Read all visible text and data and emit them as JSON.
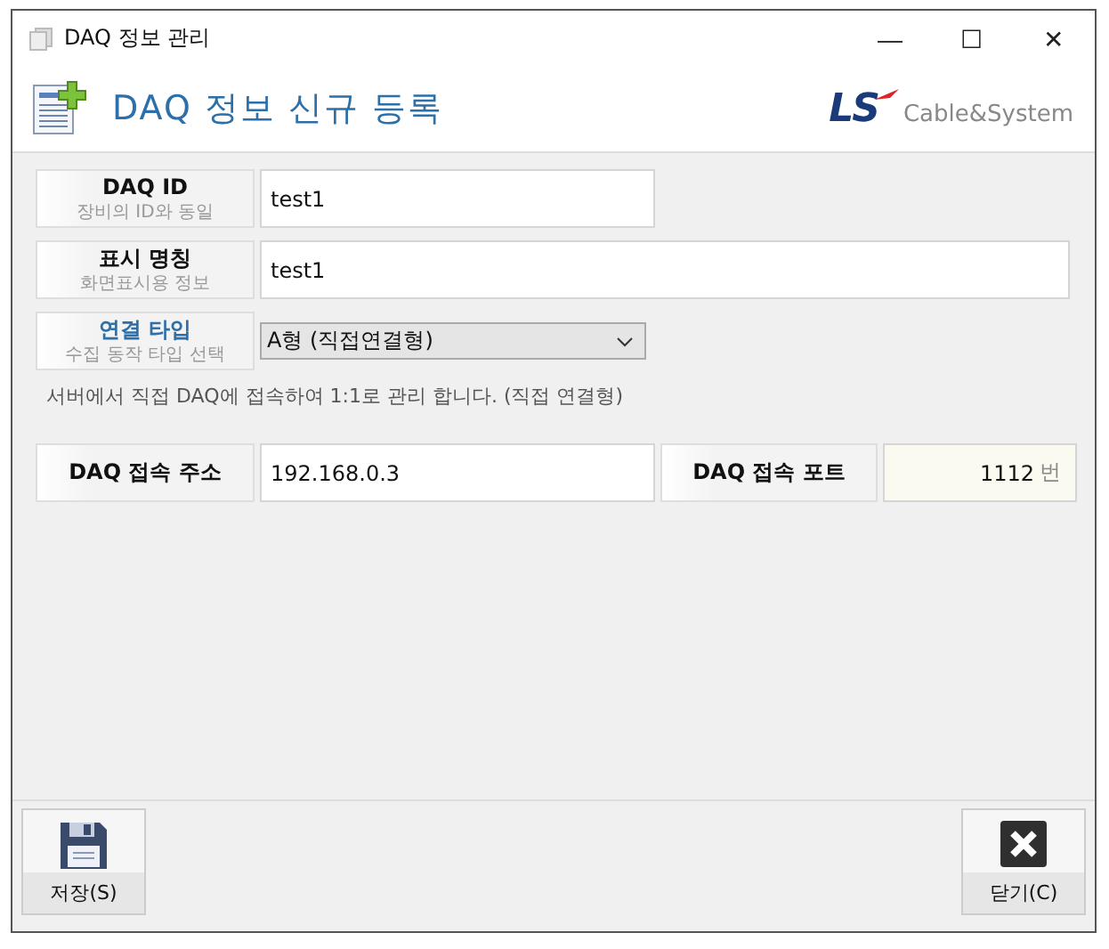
{
  "window": {
    "title": "DAQ 정보 관리",
    "controls": [
      "—",
      "☐",
      "✕"
    ]
  },
  "header": {
    "title": "DAQ 정보 신규 등록",
    "logo_mark": "LS",
    "logo_text": "Cable&System"
  },
  "fields": [
    {
      "kind": "text",
      "label": "DAQ ID",
      "sublabel": "장비의 ID와 동일",
      "emphasized": false,
      "value": "test1",
      "wide": false
    },
    {
      "kind": "text",
      "label": "표시 명칭",
      "sublabel": "화면표시용 정보",
      "emphasized": false,
      "value": "test1",
      "wide": true
    },
    {
      "kind": "select",
      "label": "연결 타입",
      "sublabel": "수집 동작 타입 선택",
      "emphasized": true,
      "value": "A형 (직접연결형)"
    }
  ],
  "hint": "서버에서 직접 DAQ에 접속하여 1:1로 관리 합니다. (직접 연결형)",
  "connection": {
    "address_label": "DAQ 접속 주소",
    "address": "192.168.0.3",
    "port_label": "DAQ 접속 포트",
    "port": "1112",
    "port_unit": "번"
  },
  "buttons": [
    {
      "kind": "save",
      "label": "저장(S)"
    },
    {
      "kind": "close",
      "label": "닫기(C)"
    }
  ]
}
